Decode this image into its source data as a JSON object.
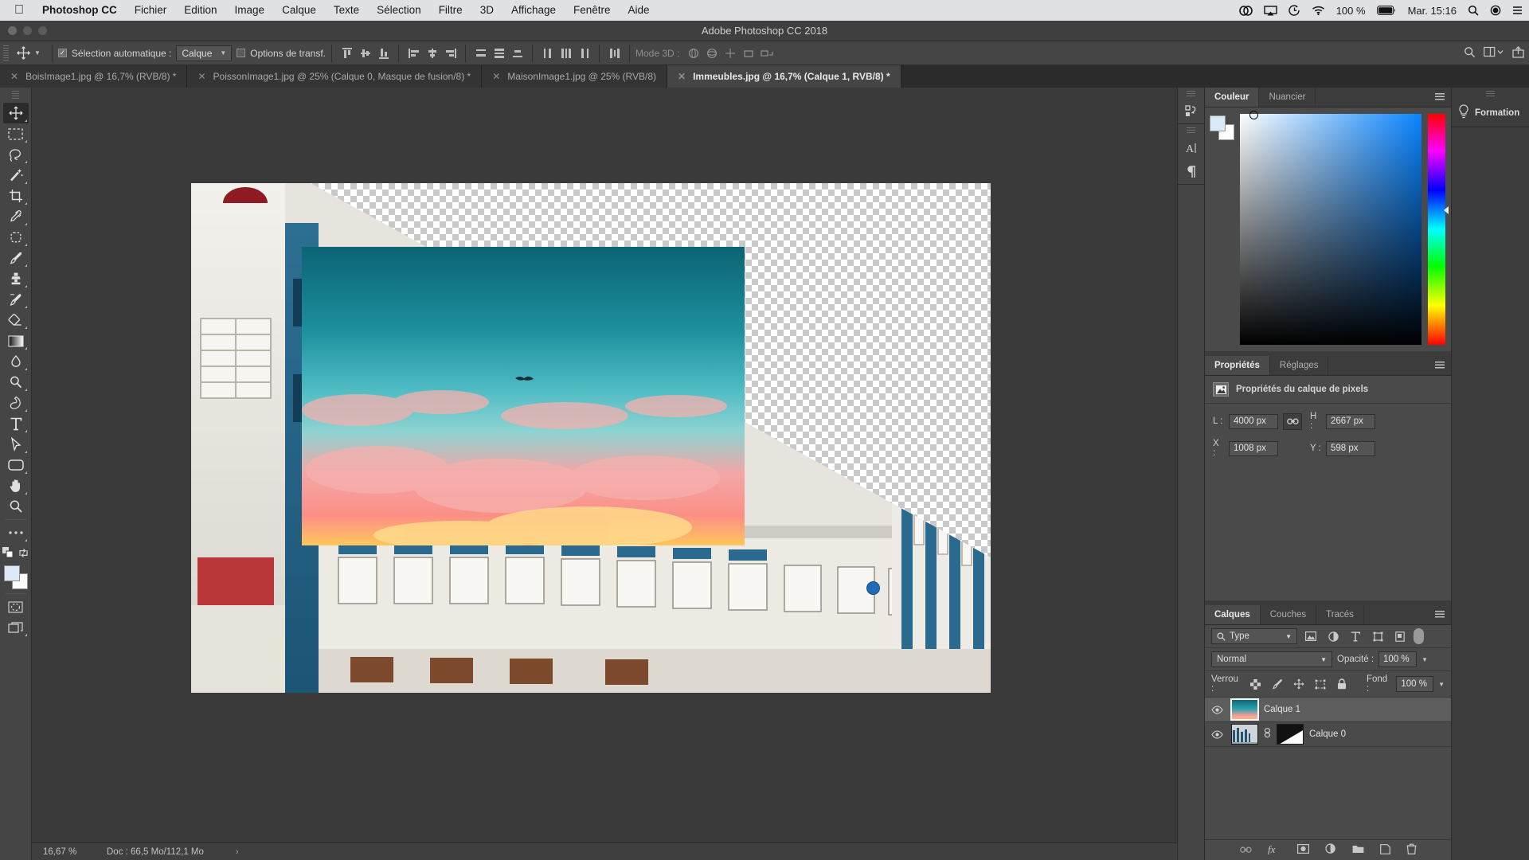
{
  "macbar": {
    "apple": "apple-logo",
    "app_name": "Photoshop CC",
    "menus": [
      "Fichier",
      "Edition",
      "Image",
      "Calque",
      "Texte",
      "Sélection",
      "Filtre",
      "3D",
      "Affichage",
      "Fenêtre",
      "Aide"
    ],
    "status_icons": [
      "creative-cloud-icon",
      "airplay-icon",
      "time-machine-icon",
      "wifi-icon"
    ],
    "battery_percent": "100 %",
    "clock": "Mar. 15:16",
    "right_icons": [
      "search-icon",
      "control-center-icon",
      "notification-icon"
    ]
  },
  "window": {
    "title": "Adobe Photoshop CC 2018"
  },
  "options_bar": {
    "tool_icon": "move-tool-icon",
    "auto_select_checked": true,
    "auto_select_label": "Sélection automatique :",
    "auto_select_value": "Calque",
    "transform_controls_checked": false,
    "transform_controls_label": "Options de transf.",
    "align_icons": [
      "align-top-edges-icon",
      "align-vertical-centers-icon",
      "align-bottom-edges-icon",
      "align-left-edges-icon",
      "align-horizontal-centers-icon",
      "align-right-edges-icon"
    ],
    "distribute_icons": [
      "distribute-top-edges-icon",
      "distribute-vertical-centers-icon",
      "distribute-bottom-edges-icon",
      "distribute-left-edges-icon",
      "distribute-horizontal-centers-icon",
      "distribute-right-edges-icon"
    ],
    "extra_icon": "distribute-spacing-icon",
    "mode3d_label": "Mode 3D :",
    "mode3d_icons": [
      "rotate-3d-icon",
      "roll-3d-icon",
      "pan-3d-icon",
      "slide-3d-icon",
      "scale-3d-icon"
    ],
    "right_icons": [
      "search-icon",
      "workspace-icon",
      "share-icon"
    ]
  },
  "tabs": [
    {
      "label": "BoisImage1.jpg @ 16,7% (RVB/8) *",
      "active": false
    },
    {
      "label": "PoissonImage1.jpg @ 25% (Calque 0, Masque de fusion/8) *",
      "active": false
    },
    {
      "label": "MaisonImage1.jpg @ 25% (RVB/8)",
      "active": false
    },
    {
      "label": "Immeubles.jpg @ 16,7% (Calque 1, RVB/8) *",
      "active": true
    }
  ],
  "tools": [
    {
      "name": "move-tool",
      "glyph": "move",
      "selected": true,
      "has_submenu": true
    },
    {
      "name": "rectangular-marquee-tool",
      "glyph": "marquee",
      "selected": false,
      "has_submenu": true
    },
    {
      "name": "lasso-tool",
      "glyph": "lasso",
      "selected": false,
      "has_submenu": true
    },
    {
      "name": "magic-wand-tool",
      "glyph": "wand",
      "selected": false,
      "has_submenu": true
    },
    {
      "name": "crop-tool",
      "glyph": "crop",
      "selected": false,
      "has_submenu": true
    },
    {
      "name": "eyedropper-tool",
      "glyph": "eyedropper",
      "selected": false,
      "has_submenu": true
    },
    {
      "name": "spot-healing-brush-tool",
      "glyph": "healing",
      "selected": false,
      "has_submenu": true
    },
    {
      "name": "brush-tool",
      "glyph": "brush",
      "selected": false,
      "has_submenu": true
    },
    {
      "name": "clone-stamp-tool",
      "glyph": "stamp",
      "selected": false,
      "has_submenu": true
    },
    {
      "name": "history-brush-tool",
      "glyph": "historybrush",
      "selected": false,
      "has_submenu": true
    },
    {
      "name": "eraser-tool",
      "glyph": "eraser",
      "selected": false,
      "has_submenu": true
    },
    {
      "name": "gradient-tool",
      "glyph": "gradient",
      "selected": false,
      "has_submenu": true
    },
    {
      "name": "blur-tool",
      "glyph": "blur",
      "selected": false,
      "has_submenu": true
    },
    {
      "name": "dodge-tool",
      "glyph": "dodge",
      "selected": false,
      "has_submenu": true
    },
    {
      "name": "pen-tool",
      "glyph": "pen",
      "selected": false,
      "has_submenu": true
    },
    {
      "name": "horizontal-type-tool",
      "glyph": "type",
      "selected": false,
      "has_submenu": true
    },
    {
      "name": "path-selection-tool",
      "glyph": "pathselect",
      "selected": false,
      "has_submenu": true
    },
    {
      "name": "rectangle-tool",
      "glyph": "rectangle",
      "selected": false,
      "has_submenu": true
    },
    {
      "name": "hand-tool",
      "glyph": "hand",
      "selected": false,
      "has_submenu": true
    },
    {
      "name": "zoom-tool",
      "glyph": "zoom",
      "selected": false,
      "has_submenu": false
    },
    {
      "name": "edit-toolbar-button",
      "glyph": "ellipsis",
      "selected": false,
      "has_submenu": true
    }
  ],
  "tool_footer": {
    "default_colors_icon": "default-colors-icon",
    "swap_colors_icon": "swap-colors-icon",
    "foreground_color": "#dbeaf7",
    "background_color": "#ffffff",
    "quick_mask_icon": "quick-mask-icon",
    "screen_mode_icon": "screen-mode-icon"
  },
  "canvas": {
    "document_name": "Immeubles.jpg",
    "layer1_thumb_colors": [
      "#0d6a78",
      "#2ea3ae",
      "#f79b9b",
      "#ffc46b"
    ],
    "bird_marker": "bird-silhouette",
    "transform_handle": "transform-handle"
  },
  "status_bar": {
    "zoom": "16,67 %",
    "doc": "Doc : 66,5 Mo/112,1 Mo",
    "arrow": "›"
  },
  "rail": {
    "buttons": [
      "layer-comps-icon",
      "character-panel-icon",
      "paragraph-panel-icon"
    ]
  },
  "color_panel": {
    "tabs": [
      {
        "label": "Couleur",
        "active": true
      },
      {
        "label": "Nuancier",
        "active": false
      }
    ],
    "menu_icon": "panel-menu-icon",
    "foreground": "#dbeaf7",
    "background": "#ffffff"
  },
  "properties_panel": {
    "tabs": [
      {
        "label": "Propriétés",
        "active": true
      },
      {
        "label": "Réglages",
        "active": false
      }
    ],
    "menu_icon": "panel-menu-icon",
    "header_icon": "pixel-layer-icon",
    "header": "Propriétés du calque de pixels",
    "fields": {
      "w_label": "L :",
      "w_value": "4000 px",
      "h_label": "H :",
      "h_value": "2667 px",
      "x_label": "X :",
      "x_value": "1008 px",
      "y_label": "Y :",
      "y_value": "598 px",
      "link_icon": "link-icon"
    }
  },
  "layers_panel": {
    "tabs": [
      {
        "label": "Calques",
        "active": true
      },
      {
        "label": "Couches",
        "active": false
      },
      {
        "label": "Tracés",
        "active": false
      }
    ],
    "menu_icon": "panel-menu-icon",
    "filter": {
      "search_icon": "search-icon",
      "type_label": "Type",
      "chevron": "chevron-down-icon",
      "filter_icons": [
        "pixel-filter-icon",
        "adjustment-filter-icon",
        "type-filter-icon",
        "shape-filter-icon",
        "smartobject-filter-icon"
      ],
      "toggle": "filter-toggle"
    },
    "blend_mode": "Normal",
    "opacity_label": "Opacité :",
    "opacity_value": "100 %",
    "lock_label": "Verrou :",
    "lock_icons": [
      "lock-transparent-pixels-icon",
      "lock-image-pixels-icon",
      "lock-position-icon",
      "lock-artboard-icon",
      "lock-all-icon"
    ],
    "fill_label": "Fond :",
    "fill_value": "100 %",
    "layers": [
      {
        "name": "Calque 1",
        "visible": true,
        "selected": true,
        "has_mask": false,
        "thumb": "sky-gradient"
      },
      {
        "name": "Calque 0",
        "visible": true,
        "selected": false,
        "has_mask": true,
        "thumb": "buildings",
        "link_icon": "mask-link-icon"
      }
    ],
    "footer_icons": [
      "link-layers-icon",
      "layer-style-icon",
      "layer-mask-icon",
      "adjustment-layer-icon",
      "new-group-icon",
      "new-layer-icon",
      "delete-layer-icon"
    ]
  },
  "formation_panel": {
    "icon": "lightbulb-icon",
    "label": "Formation"
  }
}
